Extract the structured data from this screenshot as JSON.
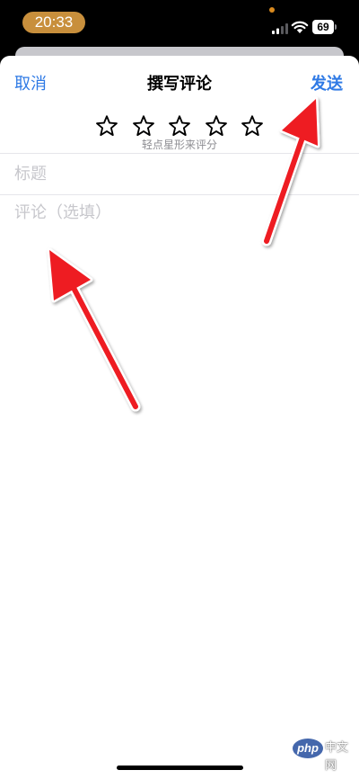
{
  "status_bar": {
    "time": "20:33",
    "battery": "69"
  },
  "nav": {
    "cancel_label": "取消",
    "title": "撰写评论",
    "send_label": "发送"
  },
  "rating": {
    "stars": 5,
    "selected": 0,
    "hint": "轻点星形来评分"
  },
  "form": {
    "title_placeholder": "标题",
    "comment_placeholder": "评论（选填）"
  },
  "watermark": {
    "brand": "php",
    "text": "中文网"
  },
  "colors": {
    "accent": "#2f7ae5",
    "time_pill": "#c88f3c",
    "arrow": "#ee1b24"
  }
}
